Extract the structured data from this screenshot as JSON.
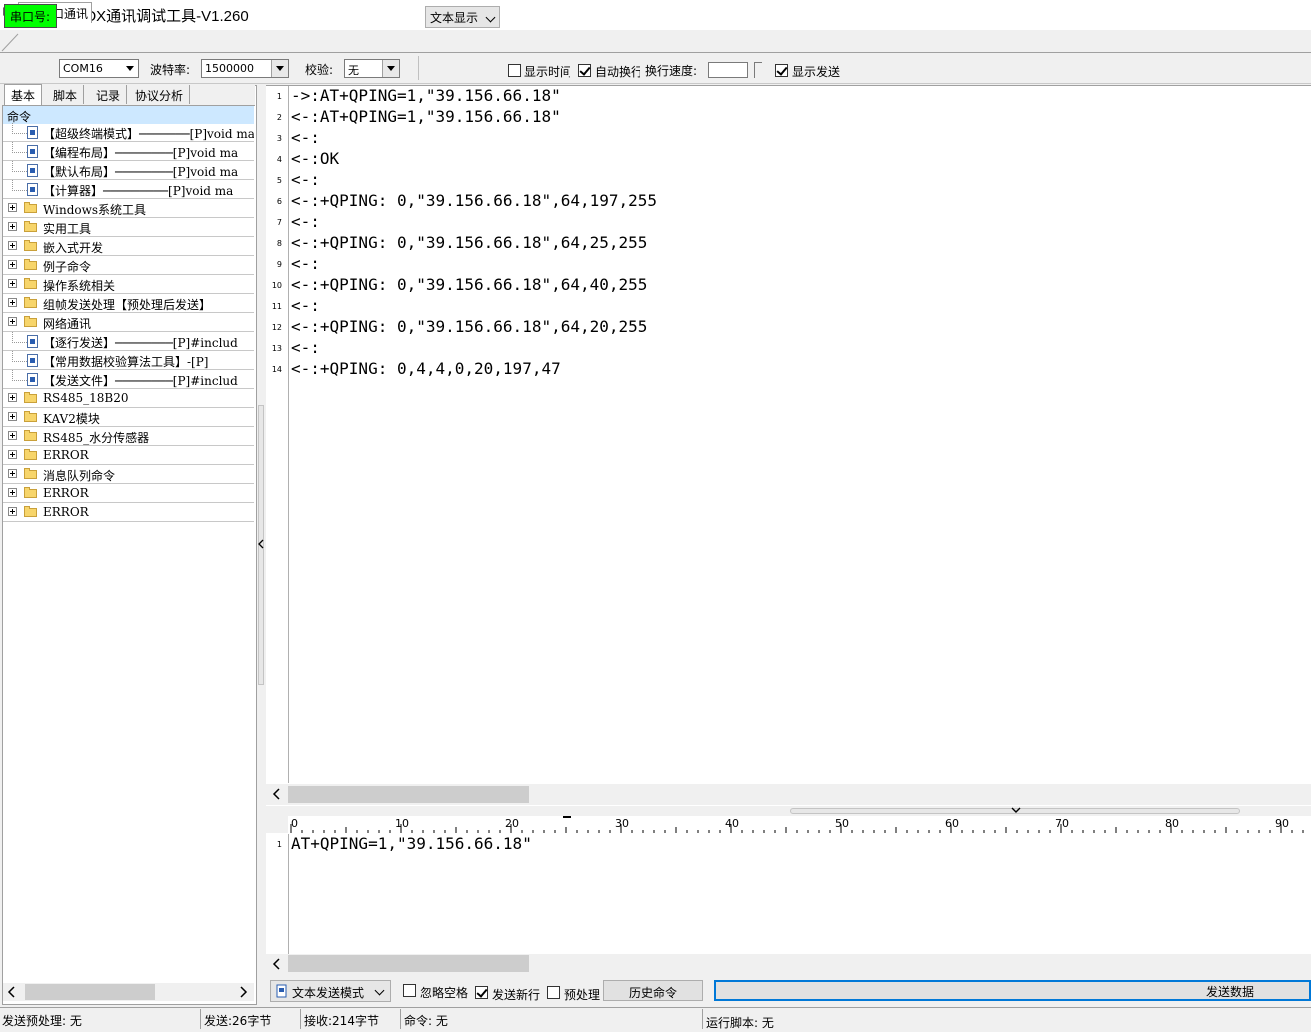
{
  "window": {
    "title": "COMMBOX通讯调试工具-V1.260"
  },
  "tabs": {
    "serial": "串口通讯"
  },
  "toolbar": {
    "port_label": "串口号:",
    "port_value": "COM16",
    "baud_label": "波特率:",
    "baud_value": "1500000",
    "parity_label": "校验:",
    "parity_value": "无",
    "display_mode": "文本显示",
    "show_time": {
      "label": "显示时间",
      "checked": false
    },
    "auto_wrap": {
      "label": "自动换行",
      "checked": true
    },
    "wrap_speed_label": "换行速度:",
    "wrap_speed_value": "",
    "show_send": {
      "label": "显示发送",
      "checked": true
    }
  },
  "left_tabs": [
    "基本",
    "脚本",
    "记录",
    "协议分析"
  ],
  "tree": {
    "header": "命令",
    "items": [
      {
        "type": "doc",
        "label": "【超级终端模式】───────[P]void ma"
      },
      {
        "type": "doc",
        "label": "【编程布局】────────[P]void ma"
      },
      {
        "type": "doc",
        "label": "【默认布局】────────[P]void ma"
      },
      {
        "type": "doc",
        "label": "【计算器】─────────[P]void ma"
      },
      {
        "type": "folder",
        "label": "Windows系统工具"
      },
      {
        "type": "folder",
        "label": "实用工具"
      },
      {
        "type": "folder",
        "label": "嵌入式开发"
      },
      {
        "type": "folder",
        "label": "例子命令"
      },
      {
        "type": "folder",
        "label": "操作系统相关"
      },
      {
        "type": "folder",
        "label": "组帧发送处理【预处理后发送】"
      },
      {
        "type": "folder",
        "label": "网络通讯"
      },
      {
        "type": "doc",
        "label": "【逐行发送】────────[P]#includ"
      },
      {
        "type": "doc",
        "label": "【常用数据校验算法工具】-[P]"
      },
      {
        "type": "doc",
        "label": "【发送文件】────────[P]#includ"
      },
      {
        "type": "folder",
        "label": "RS485_18B20"
      },
      {
        "type": "folder",
        "label": "KAV2模块"
      },
      {
        "type": "folder",
        "label": "RS485_水分传感器"
      },
      {
        "type": "folder",
        "label": "ERROR"
      },
      {
        "type": "folder",
        "label": "消息队列命令"
      },
      {
        "type": "folder",
        "label": "ERROR"
      },
      {
        "type": "folder",
        "label": "ERROR"
      }
    ]
  },
  "receive": {
    "lines": [
      {
        "n": "1",
        "text": "->:AT+QPING=1,\"39.156.66.18\""
      },
      {
        "n": "2",
        "text": "<-:AT+QPING=1,\"39.156.66.18\""
      },
      {
        "n": "3",
        "text": "<-:"
      },
      {
        "n": "4",
        "text": "<-:OK"
      },
      {
        "n": "5",
        "text": "<-:"
      },
      {
        "n": "6",
        "text": "<-:+QPING: 0,\"39.156.66.18\",64,197,255"
      },
      {
        "n": "7",
        "text": "<-:"
      },
      {
        "n": "8",
        "text": "<-:+QPING: 0,\"39.156.66.18\",64,25,255"
      },
      {
        "n": "9",
        "text": "<-:"
      },
      {
        "n": "10",
        "text": "<-:+QPING: 0,\"39.156.66.18\",64,40,255"
      },
      {
        "n": "11",
        "text": "<-:"
      },
      {
        "n": "12",
        "text": "<-:+QPING: 0,\"39.156.66.18\",64,20,255"
      },
      {
        "n": "13",
        "text": "<-:"
      },
      {
        "n": "14",
        "text": "<-:+QPING: 0,4,4,0,20,197,47"
      }
    ]
  },
  "ruler": [
    "0",
    "10",
    "20",
    "30",
    "40",
    "50",
    "60",
    "70",
    "80",
    "90"
  ],
  "send": {
    "lines": [
      {
        "n": "1",
        "text": "AT+QPING=1,\"39.156.66.18\""
      }
    ],
    "mode": "文本发送模式",
    "ignore_space": {
      "label": "忽略空格",
      "checked": false
    },
    "send_newline": {
      "label": "发送新行",
      "checked": true
    },
    "preprocess": {
      "label": "预处理",
      "checked": false
    },
    "history_button": "历史命令",
    "send_button": "发送数据"
  },
  "status": {
    "preprocess": "发送预处理: 无",
    "sent": "发送:26字节",
    "received": "接收:214字节",
    "command": "命令: 无",
    "script": "运行脚本: 无"
  }
}
